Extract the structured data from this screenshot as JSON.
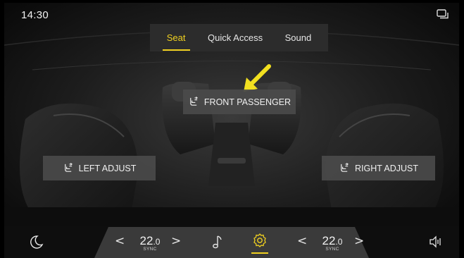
{
  "status_bar": {
    "time": "14:30",
    "icon": "screen-mirror-icon"
  },
  "tabs": [
    {
      "label": "Seat",
      "active": true
    },
    {
      "label": "Quick Access",
      "active": false
    },
    {
      "label": "Sound",
      "active": false
    }
  ],
  "seat_buttons": {
    "front_passenger": {
      "label": "FRONT PASSENGER",
      "icon": "seat-adjust-icon"
    },
    "left_adjust": {
      "label": "LEFT ADJUST",
      "icon": "seat-adjust-icon"
    },
    "right_adjust": {
      "label": "RIGHT ADJUST",
      "icon": "seat-adjust-icon"
    }
  },
  "bottom_bar": {
    "night_mode_icon": "moon-icon",
    "left_temp": {
      "value_int": "22",
      "value_dec": ".0",
      "sync": "SYNC"
    },
    "music_icon": "music-note-icon",
    "settings_icon": "gear-icon",
    "right_temp": {
      "value_int": "22",
      "value_dec": ".0",
      "sync": "SYNC"
    },
    "volume_icon": "volume-icon",
    "chevron_left": "<",
    "chevron_right": ">"
  },
  "colors": {
    "accent": "#f0d020",
    "button_bg": "#4a4a4a",
    "tab_bar_bg": "#2c2c2c"
  }
}
